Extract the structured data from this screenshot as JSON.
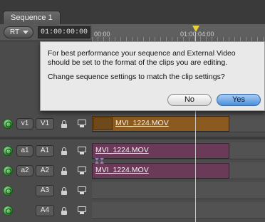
{
  "tab": {
    "label": "Sequence 1"
  },
  "header": {
    "rt_label": "RT",
    "timecode": "01:00:00:00",
    "ruler_left": "00:00",
    "ruler_mid": "01:00:04:00"
  },
  "dialog": {
    "message": "For best performance your sequence and External Video should be set to the format of the clips you are editing.",
    "question": "Change sequence settings to match the clip settings?",
    "no_label": "No",
    "yes_label": "Yes"
  },
  "tracks": [
    {
      "src": "v1",
      "dst": "V1",
      "clip": "MVI_1224.MOV",
      "kind": "video"
    },
    {
      "src": "a1",
      "dst": "A1",
      "clip": "MVI_1224.MOV",
      "kind": "audio"
    },
    {
      "src": "a2",
      "dst": "A2",
      "clip": "MVI_1224.MOV",
      "kind": "audio"
    },
    {
      "src": "",
      "dst": "A3",
      "clip": "",
      "kind": "audio"
    },
    {
      "src": "",
      "dst": "A4",
      "clip": "",
      "kind": "audio"
    }
  ],
  "colors": {
    "video_clip": "#8a5a1e",
    "audio_clip": "#6b3a59",
    "yes_button": "#4a8fdc",
    "playhead_marker": "#e8d23c"
  }
}
